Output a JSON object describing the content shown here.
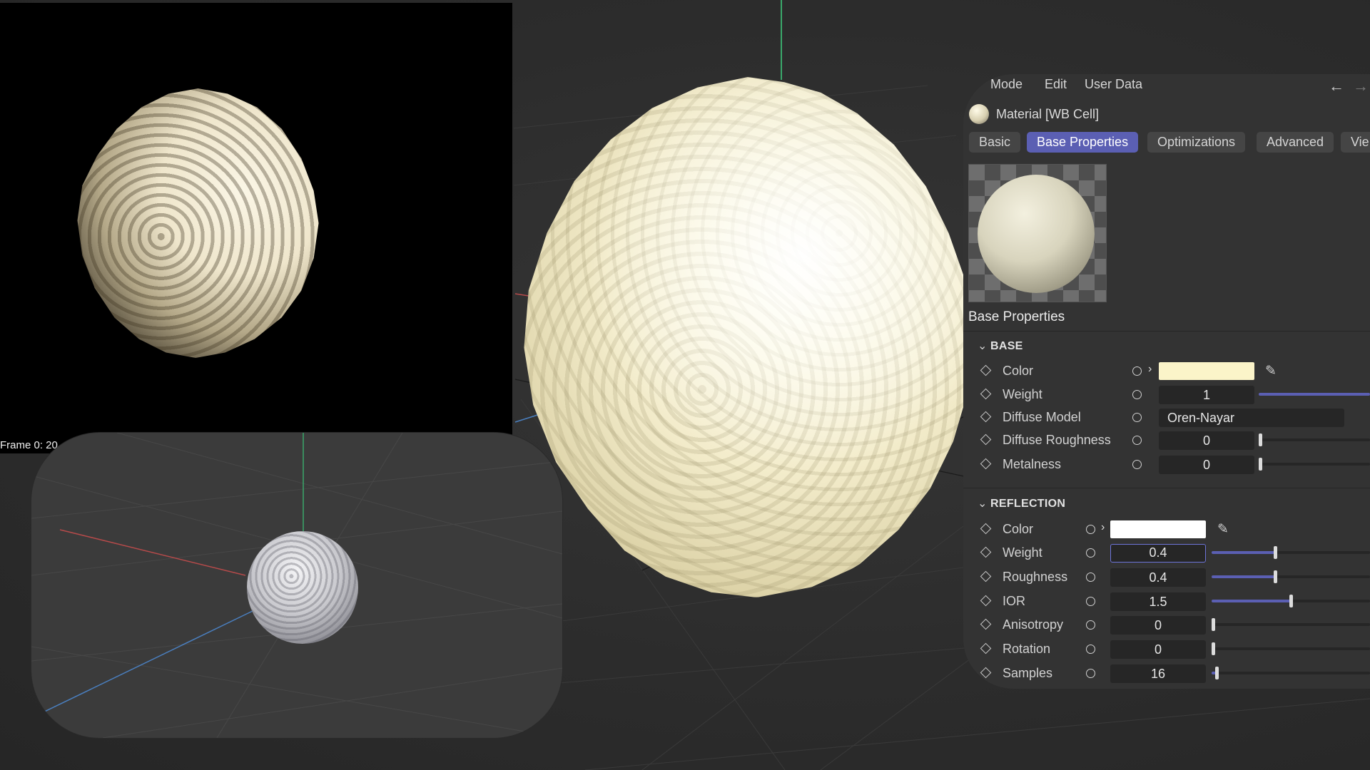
{
  "viewport": {
    "frame_label": "Frame  0:  20"
  },
  "attribute_manager": {
    "menu": {
      "mode": "Mode",
      "edit": "Edit",
      "user_data": "User Data"
    },
    "material_title": "Material [WB Cell]",
    "tabs": [
      {
        "label": "Basic",
        "active": false
      },
      {
        "label": "Base Properties",
        "active": true
      },
      {
        "label": "Optimizations",
        "active": false
      },
      {
        "label": "Advanced",
        "active": false
      },
      {
        "label": "Vie",
        "active": false
      }
    ],
    "section_title": "Base Properties",
    "base": {
      "heading": "BASE",
      "rows": [
        {
          "label": "Color",
          "swatch_color": "#fbf4c9"
        },
        {
          "label": "Weight",
          "value": "1",
          "slider": 1.0
        },
        {
          "label": "Diffuse Model",
          "value": "Oren-Nayar"
        },
        {
          "label": "Diffuse Roughness",
          "value": "0",
          "slider": 0.0
        },
        {
          "label": "Metalness",
          "value": "0",
          "slider": 0.0
        }
      ]
    },
    "reflection": {
      "heading": "REFLECTION",
      "rows": [
        {
          "label": "Color",
          "swatch_color": "#ffffff"
        },
        {
          "label": "Weight",
          "value": "0.4",
          "slider": 0.4
        },
        {
          "label": "Roughness",
          "value": "0.4",
          "slider": 0.4
        },
        {
          "label": "IOR",
          "value": "1.5",
          "slider": 0.5
        },
        {
          "label": "Anisotropy",
          "value": "0",
          "slider": 0.0
        },
        {
          "label": "Rotation",
          "value": "0",
          "slider": 0.0
        },
        {
          "label": "Samples",
          "value": "16",
          "slider": 0.03
        }
      ]
    },
    "colors": {
      "accent": "#5b5fb3",
      "panel_bg": "#333333",
      "field_bg": "#262626"
    }
  }
}
